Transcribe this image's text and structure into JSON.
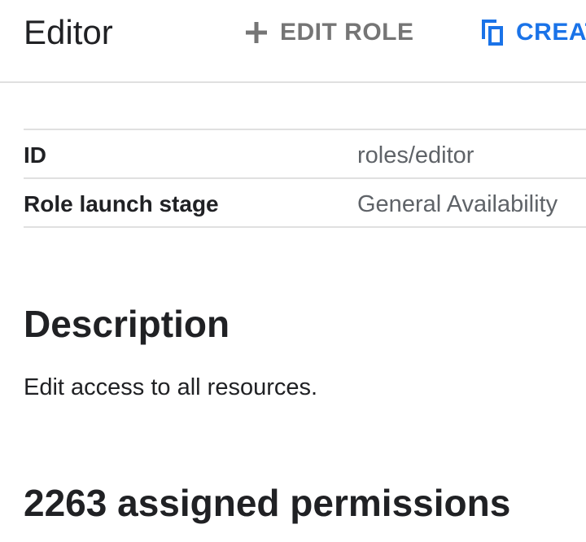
{
  "header": {
    "title": "Editor",
    "actions": {
      "edit_role": {
        "label": "EDIT ROLE",
        "icon": "plus-icon",
        "color": "#757575"
      },
      "create_role": {
        "label": "CREAT",
        "icon": "copy-icon",
        "color": "#1a73e8"
      }
    }
  },
  "properties": [
    {
      "label": "ID",
      "value": "roles/editor"
    },
    {
      "label": "Role launch stage",
      "value": "General Availability"
    }
  ],
  "description": {
    "heading": "Description",
    "text": "Edit access to all resources."
  },
  "permissions": {
    "heading": "2263 assigned permissions"
  }
}
